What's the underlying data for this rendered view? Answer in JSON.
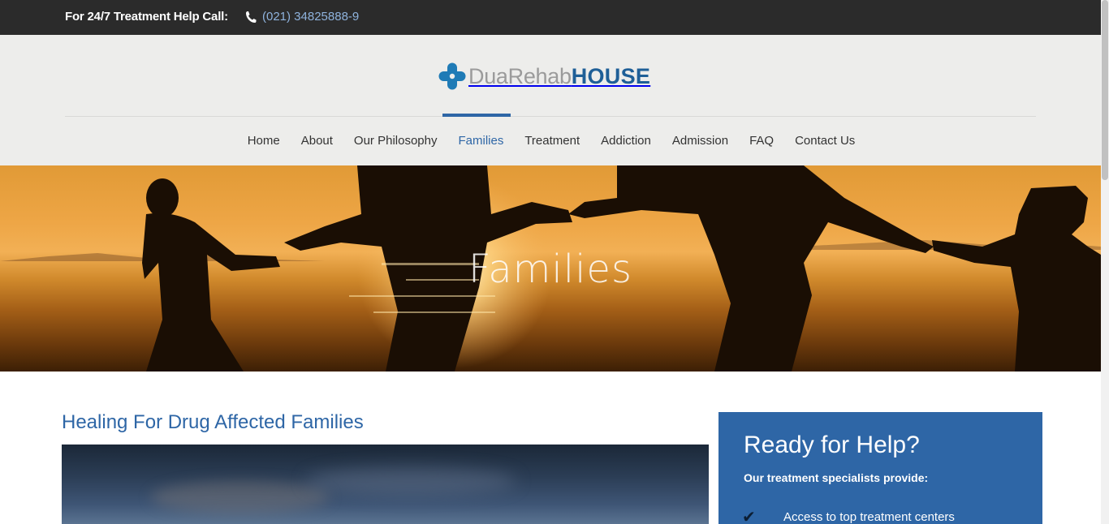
{
  "topbar": {
    "help_text": "For 24/7 Treatment Help Call:",
    "phone": "(021) 34825888-9",
    "icon": "phone-icon"
  },
  "logo": {
    "icon": "medical-cross-icon",
    "part1": "DuaRehab",
    "part2": "HOUSE",
    "colors": {
      "cross": "#1f7bb6",
      "dua": "#9b9b9b",
      "house": "#1f5f97"
    }
  },
  "nav": {
    "items": [
      {
        "label": "Home"
      },
      {
        "label": "About"
      },
      {
        "label": "Our Philosophy"
      },
      {
        "label": "Families",
        "active": true
      },
      {
        "label": "Treatment"
      },
      {
        "label": "Addiction"
      },
      {
        "label": "Admission"
      },
      {
        "label": "FAQ"
      },
      {
        "label": "Contact Us"
      }
    ],
    "active_color": "#2e66a6"
  },
  "hero": {
    "title": "Families"
  },
  "content": {
    "heading": "Healing For Drug Affected Families"
  },
  "sidebar": {
    "title": "Ready for Help?",
    "subtitle": "Our treatment specialists provide:",
    "items": [
      {
        "icon": "checkmark-icon",
        "label": "Access to top treatment centers"
      }
    ],
    "background": "#2e66a6"
  },
  "colors": {
    "topbar_bg": "#2b2b2b",
    "header_bg": "#ededeb",
    "accent": "#2e66a6"
  }
}
